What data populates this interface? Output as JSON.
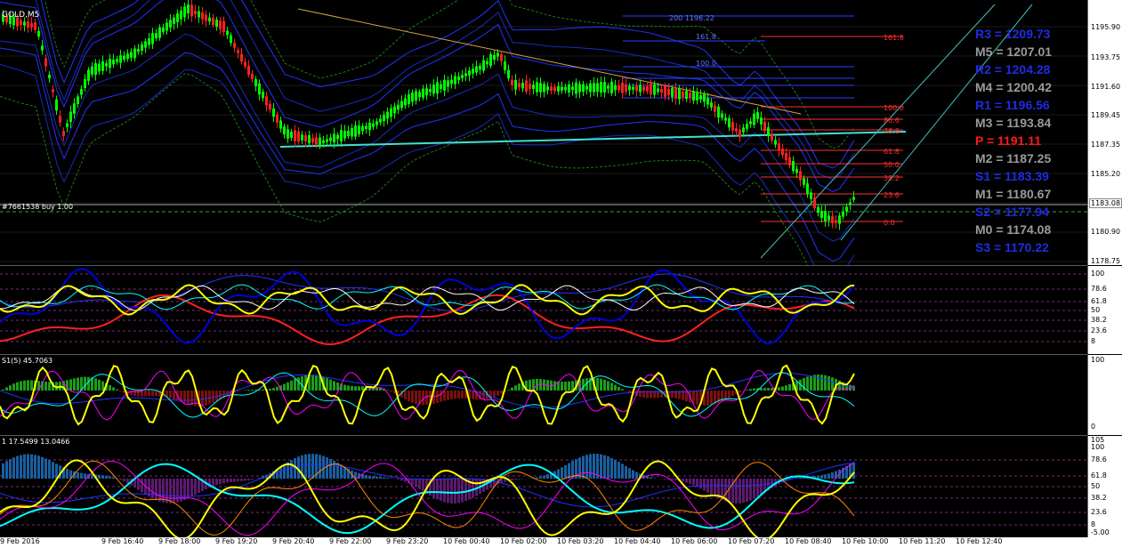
{
  "symbol_label": "GOLD,M5",
  "order_label": "#7661538 buy 1.00",
  "price_tag": "1183.08",
  "price_axis": [
    "1195.90",
    "1193.75",
    "1191.60",
    "1189.45",
    "1187.35",
    "1185.20",
    "1180.90",
    "1178.75"
  ],
  "pivots": [
    {
      "text": "R3 = 1209.73",
      "color": "#1e2ce0"
    },
    {
      "text": "M5 = 1207.01",
      "color": "#9a9a9a"
    },
    {
      "text": "R2 = 1204.28",
      "color": "#1e2ce0"
    },
    {
      "text": "M4 = 1200.42",
      "color": "#9a9a9a"
    },
    {
      "text": "R1 = 1196.56",
      "color": "#1e2ce0"
    },
    {
      "text": "M3 = 1193.84",
      "color": "#9a9a9a"
    },
    {
      "text": "P  = 1191.11",
      "color": "#ff1a1a"
    },
    {
      "text": "M2 = 1187.25",
      "color": "#9a9a9a"
    },
    {
      "text": "S1 = 1183.39",
      "color": "#1e2ce0"
    },
    {
      "text": "M1 = 1180.67",
      "color": "#9a9a9a"
    },
    {
      "text": "S2 = 1177.94",
      "color": "#1e2ce0"
    },
    {
      "text": "M0 = 1174.08",
      "color": "#9a9a9a"
    },
    {
      "text": "S3 = 1170.22",
      "color": "#1e2ce0"
    }
  ],
  "fib_left": {
    "top_label": "200 1196.22",
    "levels": [
      "161.8",
      "100.0"
    ]
  },
  "fib_right": [
    "161.8",
    "100.0",
    "86.6",
    "78.6",
    "61.8",
    "50.0",
    "38.2",
    "23.6",
    "0.0"
  ],
  "osc1_axis": [
    "100",
    "78.6",
    "61.8",
    "50",
    "38.2",
    "23.6",
    "8"
  ],
  "osc2_label": "S1(5) 45.7063",
  "osc2_axis": [
    "100",
    "0"
  ],
  "osc3_label": "1 17.5499 13.0466",
  "osc3_axis": [
    "105",
    "100",
    "78.6",
    "61.8",
    "50",
    "38.2",
    "23.6",
    "8",
    "-5.00"
  ],
  "time_axis": [
    "9 Feb 2016",
    "9 Feb 16:40",
    "9 Feb 18:00",
    "9 Feb 19:20",
    "9 Feb 20:40",
    "9 Feb 22:00",
    "9 Feb 23:20",
    "10 Feb 00:40",
    "10 Feb 02:00",
    "10 Feb 03:20",
    "10 Feb 04:40",
    "10 Feb 06:00",
    "10 Feb 07:20",
    "10 Feb 08:40",
    "10 Feb 10:00",
    "10 Feb 11:20",
    "10 Feb 12:40"
  ],
  "colors": {
    "bull": "#00ff00",
    "bear": "#ff2020",
    "fib": "#ff3030",
    "band": "#2233ff",
    "yellow": "#ffff00"
  }
}
